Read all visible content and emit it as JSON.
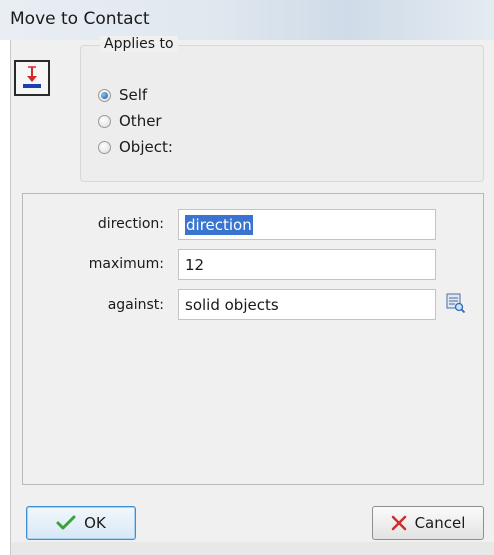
{
  "window": {
    "title": "Move to Contact"
  },
  "action_icon": "move-to-contact-icon",
  "applies_to": {
    "legend": "Applies to",
    "options": [
      {
        "label": "Self",
        "checked": true
      },
      {
        "label": "Other",
        "checked": false
      },
      {
        "label": "Object:",
        "checked": false
      }
    ]
  },
  "params": {
    "direction": {
      "label": "direction:",
      "value": "direction",
      "selected": true
    },
    "maximum": {
      "label": "maximum:",
      "value": "12"
    },
    "against": {
      "label": "against:",
      "value": "solid objects",
      "icon": "object-picker-icon"
    }
  },
  "buttons": {
    "ok_label": "OK",
    "cancel_label": "Cancel"
  },
  "colors": {
    "selection": "#3874d0",
    "ok_check": "#3aa23a",
    "cancel_x": "#d02c2c"
  }
}
